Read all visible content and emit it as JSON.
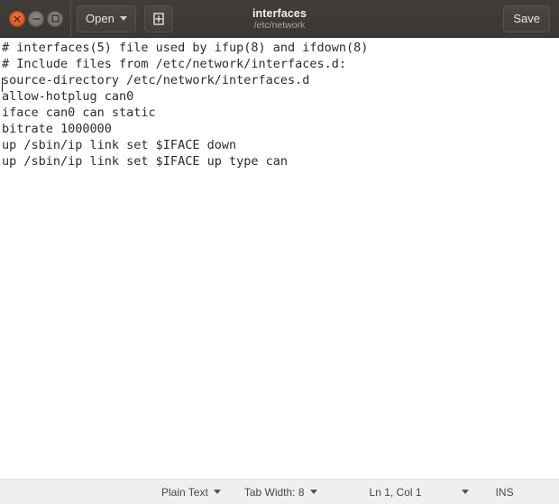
{
  "window": {
    "title": "interfaces",
    "subtitle": "/etc/network",
    "controls": {
      "close_label": "close-window",
      "minimize_label": "minimize-window",
      "maximize_label": "maximize-window"
    }
  },
  "header": {
    "open_label": "Open",
    "new_document_label": "New Document",
    "save_label": "Save"
  },
  "editor": {
    "lines": [
      "# interfaces(5) file used by ifup(8) and ifdown(8)",
      "# Include files from /etc/network/interfaces.d:",
      "source-directory /etc/network/interfaces.d",
      "allow-hotplug can0",
      "iface can0 can static",
      "bitrate 1000000",
      "up /sbin/ip link set $IFACE down",
      "up /sbin/ip link set $IFACE up type can"
    ],
    "text_color": "#2b2b2b",
    "background": "#ffffff"
  },
  "statusbar": {
    "language": "Plain Text",
    "tab_width": "Tab Width: 8",
    "position": "Ln 1, Col 1",
    "insert_mode": "INS",
    "background": "#f0efee"
  },
  "theme": {
    "headerbar_bg": "#3e3b38",
    "close_button": "#dd5c27",
    "header_text": "#e8e5e0",
    "subtitle_text": "#a8a49e"
  }
}
